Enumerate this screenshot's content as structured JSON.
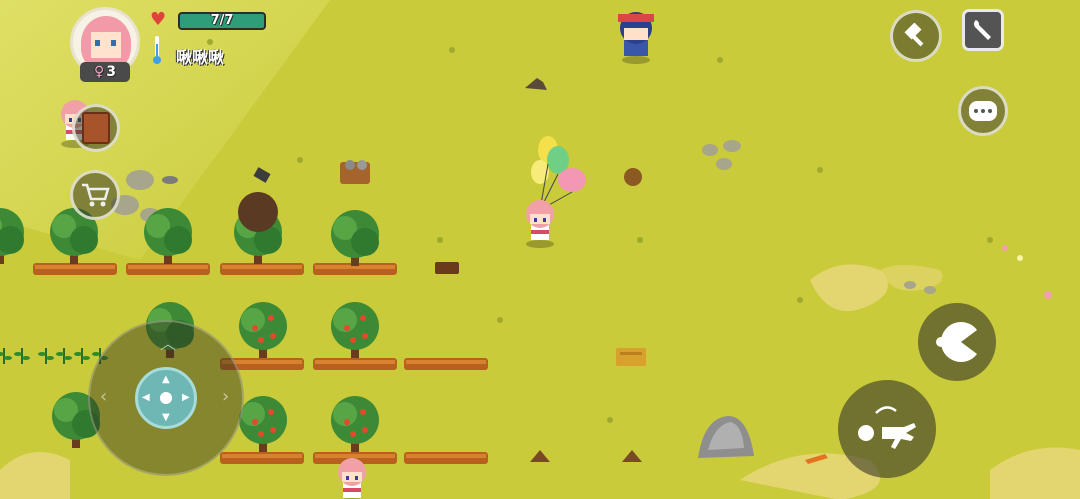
{
  "hud": {
    "health_text": "7/7",
    "health_fraction": 1.0,
    "player_name": "啾啾啾",
    "level_badge": "3",
    "level_symbol": "♀"
  },
  "colors": {
    "grass": "#c9cb3a",
    "health_bar": "#2e9e7a",
    "heart": "#e0433b",
    "dpad": "#6fb7b5"
  }
}
